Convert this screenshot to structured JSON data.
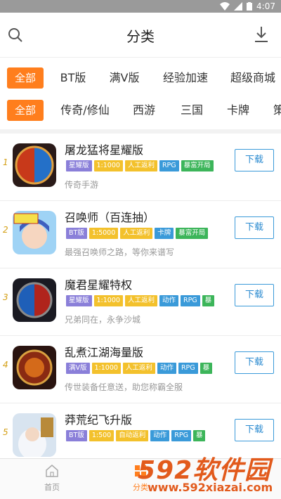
{
  "status": {
    "time": "4:07"
  },
  "header": {
    "title": "分类"
  },
  "tabs_row1": [
    "全部",
    "BT版",
    "满V版",
    "经验加速",
    "超级商城"
  ],
  "tabs_row2": [
    "全部",
    "传奇/修仙",
    "西游",
    "三国",
    "卡牌",
    "策"
  ],
  "games": [
    {
      "rank": "1",
      "name": "屠龙猛将星耀版",
      "desc": "传奇手游",
      "tags": [
        [
          "星耀版",
          "#8a7fd9"
        ],
        [
          "1:1000",
          "#f3c12c"
        ],
        [
          "人工返利",
          "#f3c12c"
        ],
        [
          "RPG",
          "#3a9ad9"
        ],
        [
          "暴富开局",
          "#3cb55a"
        ]
      ]
    },
    {
      "rank": "2",
      "name": "召唤师（百连抽）",
      "desc": "最强召唤师之路，等你来谱写",
      "tags": [
        [
          "BT版",
          "#8a7fd9"
        ],
        [
          "1:5000",
          "#f3c12c"
        ],
        [
          "人工返利",
          "#f3c12c"
        ],
        [
          "卡牌",
          "#3a9ad9"
        ],
        [
          "暴富开局",
          "#3cb55a"
        ]
      ]
    },
    {
      "rank": "3",
      "name": "魔君星耀特权",
      "desc": "兄弟同在，永争沙城",
      "tags": [
        [
          "星耀版",
          "#8a7fd9"
        ],
        [
          "1:1000",
          "#f3c12c"
        ],
        [
          "人工返利",
          "#f3c12c"
        ],
        [
          "动作",
          "#3a9ad9"
        ],
        [
          "RPG",
          "#3a9ad9"
        ],
        [
          "暴",
          "#3cb55a"
        ]
      ]
    },
    {
      "rank": "4",
      "name": "乱煮江湖海量版",
      "desc": "传世装备任意送，助您称霸全服",
      "tags": [
        [
          "满V版",
          "#8a7fd9"
        ],
        [
          "1:1000",
          "#f3c12c"
        ],
        [
          "人工返利",
          "#f3c12c"
        ],
        [
          "动作",
          "#3a9ad9"
        ],
        [
          "RPG",
          "#3a9ad9"
        ],
        [
          "暴",
          "#3cb55a"
        ]
      ]
    },
    {
      "rank": "5",
      "name": "莽荒纪飞升版",
      "desc": "",
      "tags": [
        [
          "BT版",
          "#8a7fd9"
        ],
        [
          "1:500",
          "#f3c12c"
        ],
        [
          "自动返利",
          "#f3c12c"
        ],
        [
          "动作",
          "#3a9ad9"
        ],
        [
          "RPG",
          "#3a9ad9"
        ],
        [
          "暴",
          "#3cb55a"
        ]
      ]
    }
  ],
  "download_label": "下载",
  "nav": {
    "home": "首页",
    "category": "分类"
  },
  "watermark": {
    "big": "592软件园",
    "small": "www.592xiazai.com"
  },
  "colors": {
    "accent": "#ff7e1d",
    "link": "#3a9ad9"
  }
}
